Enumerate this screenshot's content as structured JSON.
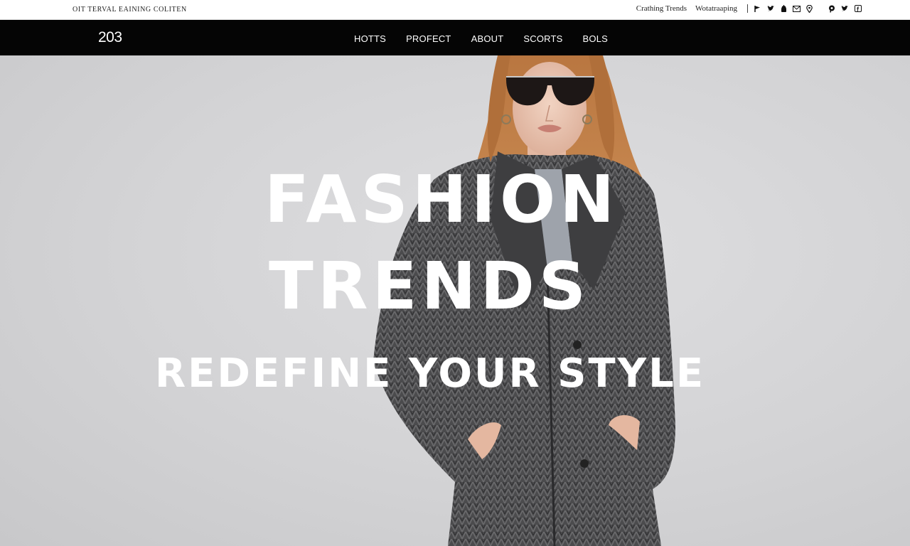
{
  "topbar": {
    "tagline": "OIT TERVAL EAINING COLITEN",
    "links": [
      "Crathing Trends",
      "Wotatraaping"
    ]
  },
  "navbar": {
    "logo": "203",
    "items": [
      "HOTTS",
      "PROFECT",
      "ABOUT",
      "SCORTS",
      "BOLS"
    ]
  },
  "social_icons": [
    "flag-icon",
    "twitter-icon",
    "android-icon",
    "mail-icon",
    "location-pin-icon",
    "pinterest-icon",
    "twitter-icon",
    "facebook-icon"
  ],
  "hero": {
    "line1": "FASHION",
    "line2": "TRENDS",
    "subtitle": "REDEFINE YOUR STYLE"
  },
  "colors": {
    "navbar_bg": "#050505",
    "hero_bg": "#d2d2d4",
    "headline": "#ffffff",
    "coat": "#4a4a4c"
  }
}
